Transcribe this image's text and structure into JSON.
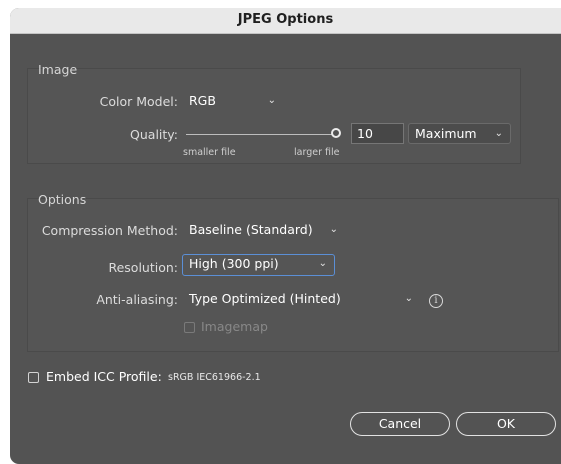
{
  "dialog": {
    "title": "JPEG Options"
  },
  "image_section": {
    "title": "Image",
    "color_model": {
      "label": "Color Model:",
      "value": "RGB"
    },
    "quality": {
      "label": "Quality:",
      "smaller_label": "smaller file",
      "larger_label": "larger file",
      "value": "10",
      "preset": "Maximum"
    }
  },
  "options_section": {
    "title": "Options",
    "compression": {
      "label": "Compression Method:",
      "value": "Baseline (Standard)"
    },
    "resolution": {
      "label": "Resolution:",
      "value": "High (300 ppi)"
    },
    "antialiasing": {
      "label": "Anti-aliasing:",
      "value": "Type Optimized (Hinted)"
    },
    "imagemap": {
      "label": "Imagemap",
      "checked": false,
      "enabled": false
    }
  },
  "icc": {
    "label": "Embed ICC Profile:",
    "profile": "sRGB IEC61966-2.1",
    "checked": false
  },
  "buttons": {
    "cancel": "Cancel",
    "ok": "OK"
  },
  "icons": {
    "chevron": "chevron-down-icon",
    "info": "info-icon"
  },
  "colors": {
    "focus_accent": "#5b8fd6",
    "dialog_bg": "#535353",
    "titlebar_bg": "#e9e9e9"
  }
}
